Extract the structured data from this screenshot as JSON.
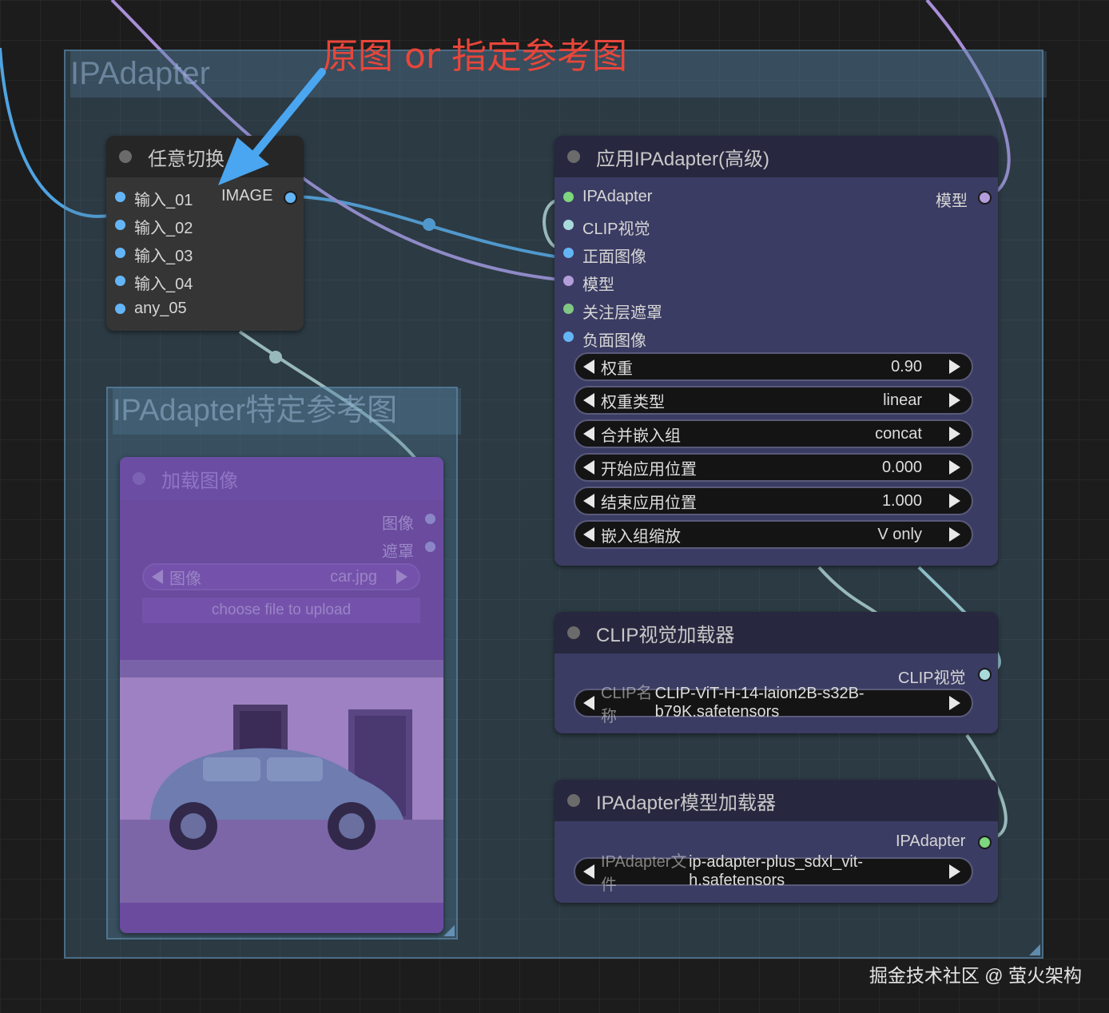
{
  "annotation": {
    "text": "原图 or 指定参考图"
  },
  "groups": {
    "main": {
      "title": "IPAdapter"
    },
    "ref": {
      "title": "IPAdapter特定参考图"
    }
  },
  "switch_node": {
    "title": "任意切换",
    "inputs": [
      "输入_01",
      "输入_02",
      "输入_03",
      "输入_04",
      "any_05"
    ],
    "output": "IMAGE"
  },
  "load_image_node": {
    "title": "加载图像",
    "outputs": [
      "图像",
      "遮罩"
    ],
    "image_widget": {
      "label": "图像",
      "value": "car.jpg"
    },
    "upload_label": "choose file to upload"
  },
  "apply_node": {
    "title": "应用IPAdapter(高级)",
    "inputs": [
      "IPAdapter",
      "CLIP视觉",
      "正面图像",
      "模型",
      "关注层遮罩",
      "负面图像"
    ],
    "output": "模型",
    "widgets": [
      {
        "label": "权重",
        "value": "0.90"
      },
      {
        "label": "权重类型",
        "value": "linear"
      },
      {
        "label": "合并嵌入组",
        "value": "concat"
      },
      {
        "label": "开始应用位置",
        "value": "0.000"
      },
      {
        "label": "结束应用位置",
        "value": "1.000"
      },
      {
        "label": "嵌入组缩放",
        "value": "V only"
      }
    ]
  },
  "clip_node": {
    "title": "CLIP视觉加载器",
    "output": "CLIP视觉",
    "widget_label": "CLIP名称",
    "widget_value": "CLIP-ViT-H-14-laion2B-s32B-b79K.safetensors"
  },
  "ipa_loader_node": {
    "title": "IPAdapter模型加载器",
    "output": "IPAdapter",
    "widget_label": "IPAdapter文件",
    "widget_value": "ip-adapter-plus_sdxl_vit-h.safetensors"
  },
  "watermark": "掘金技术社区 @ 萤火架构",
  "colors": {
    "image": "#64b5f6",
    "clip_vision": "#a8dadc",
    "ipadapter": "#7ed67e",
    "model": "#b39ddb",
    "mask": "#81c784",
    "annotation": "#e8463a"
  }
}
